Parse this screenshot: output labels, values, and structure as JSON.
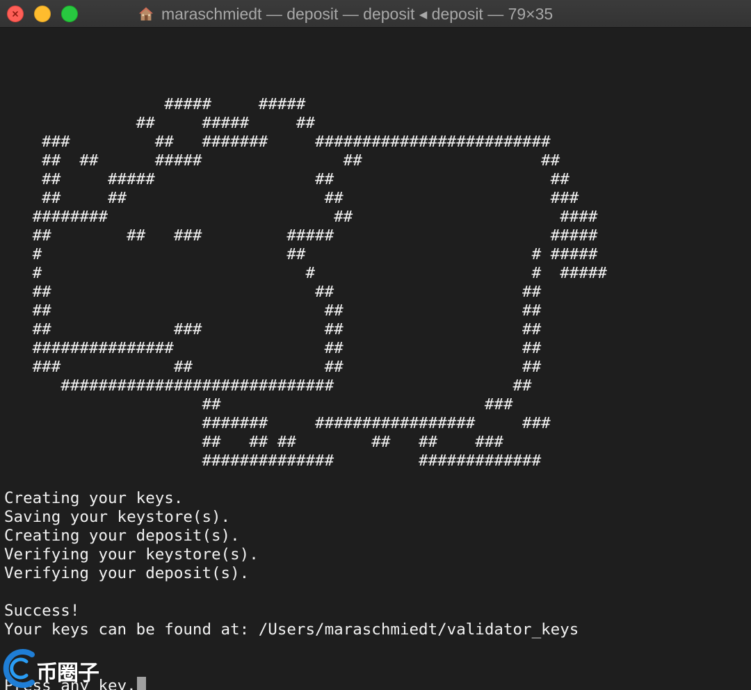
{
  "window": {
    "title": "maraschmiedt — deposit — deposit ◂ deposit — 79×35",
    "title_icon": "home-icon",
    "colors": {
      "background": "#1e1e1e",
      "text": "#f2f2f2",
      "titlebar": "#383838",
      "close": "#fe5f57",
      "minimize": "#febc2e",
      "zoom": "#28c840"
    }
  },
  "terminal": {
    "lines": [
      "",
      "",
      "                 #####     #####",
      "              ##     #####     ##",
      "    ###         ##   #######     #########################",
      "    ##  ##      #####               ##                   ##",
      "    ##     #####                 ##                       ##",
      "    ##     ##                     ##                      ###",
      "   ########                        ##                      ####",
      "   ##        ##   ###         #####                       #####",
      "   #                          ##                        # #####",
      "   #                            #                       #  #####",
      "   ##                            ##                    ##",
      "   ##                             ##                   ##",
      "   ##             ###             ##                   ##",
      "   ###############                ##                   ##",
      "   ###            ##              ##                   ##",
      "      #############################                   ##",
      "                     ##                            ###",
      "                     #######     #################     ###",
      "                     ##   ## ##        ##   ##    ###",
      "                     ##############         #############",
      "",
      "Creating your keys.",
      "Saving your keystore(s).",
      "Creating your deposit(s).",
      "Verifying your keystore(s).",
      "Verifying your deposit(s).",
      "",
      "Success!",
      "Your keys can be found at: /Users/maraschmiedt/validator_keys",
      "",
      "",
      "Press any key."
    ],
    "cursor": "block-cursor"
  },
  "watermark": {
    "text": "币圈子",
    "icon": "coin-logo-icon"
  }
}
